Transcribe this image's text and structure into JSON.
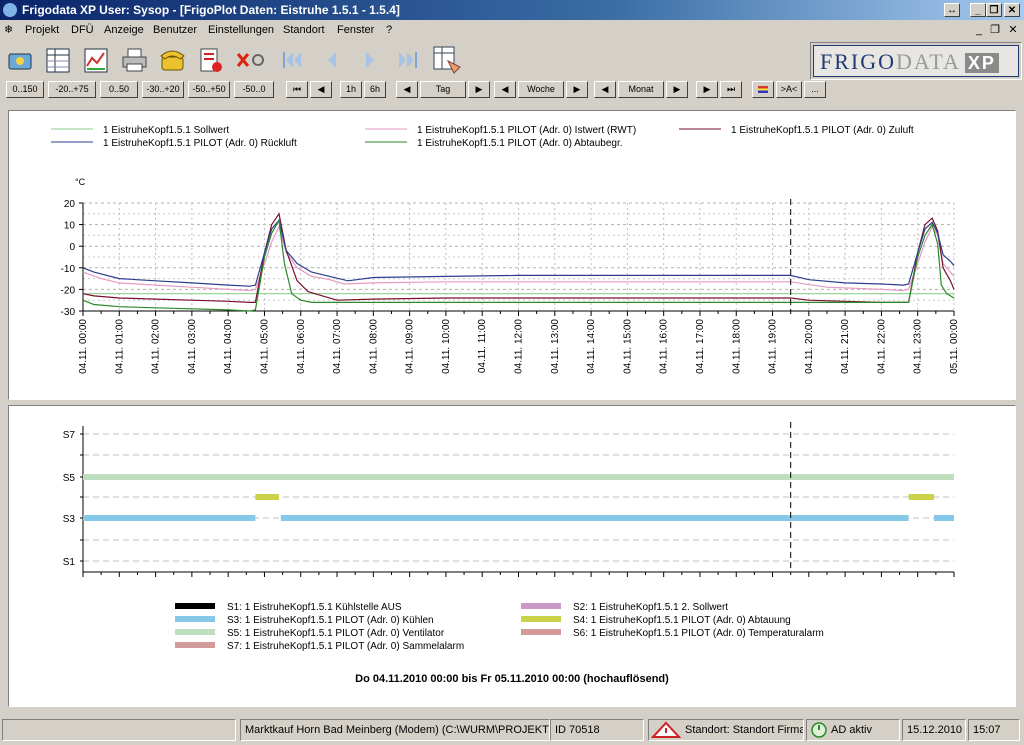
{
  "window": {
    "title": "Frigodata XP  User: Sysop - [FrigoPlot Daten: Eistruhe    1.5.1 - 1.5.4]"
  },
  "menu": {
    "items": [
      "Projekt",
      "DFÜ",
      "Anzeige",
      "Benutzer",
      "Einstellungen",
      "Standort",
      "Fenster",
      "?"
    ]
  },
  "toolbar": {
    "icons": [
      "projects-icon",
      "table-icon",
      "plot-icon",
      "print-icon",
      "phone-icon",
      "alarm-list-icon",
      "disconnect-icon",
      "first-icon",
      "prev-icon",
      "next-icon",
      "last-icon",
      "data-view-icon"
    ]
  },
  "logo": {
    "part1": "FRIGO",
    "part2": "DATA",
    "part3": "XP"
  },
  "range_buttons": [
    "0..150",
    "-20..+75",
    "0..50",
    "-30..+20",
    "-50..+50",
    "-50..0"
  ],
  "nav_buttons": {
    "h1": "1h",
    "h6": "6h",
    "day": "Tag",
    "week": "Woche",
    "month": "Monat",
    "ac": ">A<",
    "more": "..."
  },
  "chart_data": [
    {
      "type": "line",
      "ylabel": "°C",
      "ylim": [
        -30,
        20
      ],
      "yticks": [
        20,
        10,
        0,
        -10,
        -20,
        -30
      ],
      "yticks_minor": [
        15,
        5,
        -5,
        -15,
        -25
      ],
      "x_tick_labels": [
        "04.11. 00:00",
        "04.11. 01:00",
        "04.11. 02:00",
        "04.11. 03:00",
        "04.11. 04:00",
        "04.11. 05:00",
        "04.11. 06:00",
        "04.11. 07:00",
        "04.11. 08:00",
        "04.11. 09:00",
        "04.11. 10:00",
        "04.11. 11:00",
        "04.11. 12:00",
        "04.11. 13:00",
        "04.11. 14:00",
        "04.11. 15:00",
        "04.11. 16:00",
        "04.11. 17:00",
        "04.11. 18:00",
        "04.11. 19:00",
        "04.11. 20:00",
        "04.11. 21:00",
        "04.11. 22:00",
        "04.11. 23:00",
        "05.11. 00:00"
      ],
      "xlim": [
        0,
        24
      ],
      "cursor_x": 19.5,
      "grid": true,
      "legend": [
        {
          "name": "1 EistruheKopf1.5.1  Sollwert",
          "color": "#8ed18e"
        },
        {
          "name": "1 EistruheKopf1.5.1  PILOT (Adr. 0) Istwert (RWT)",
          "color": "#e79ac4"
        },
        {
          "name": "1 EistruheKopf1.5.1  PILOT (Adr. 0) Zuluft",
          "color": "#7a1030"
        },
        {
          "name": "1 EistruheKopf1.5.1  PILOT (Adr. 0) Rückluft",
          "color": "#2c3d8f"
        },
        {
          "name": "1 EistruheKopf1.5.1  PILOT (Adr. 0) Abtaubegr.",
          "color": "#2a8a2a"
        }
      ],
      "series": [
        {
          "name": "1 EistruheKopf1.5.1  Sollwert",
          "color": "#8ed18e",
          "x": [
            0,
            24
          ],
          "y": [
            -22,
            -22
          ]
        },
        {
          "name": "1 EistruheKopf1.5.1  PILOT (Adr. 0) Istwert (RWT)",
          "color": "#e79ac4",
          "x": [
            0,
            0.5,
            1,
            2,
            3,
            4,
            4.6,
            4.75,
            5.0,
            5.2,
            5.4,
            5.6,
            5.9,
            6.3,
            6.8,
            7.2,
            8,
            10,
            12,
            14,
            16,
            18,
            19.5,
            20.5,
            22,
            22.6,
            22.75,
            23.0,
            23.2,
            23.4,
            23.55,
            23.7,
            23.9,
            24
          ],
          "y": [
            -12,
            -15,
            -17,
            -18,
            -19,
            -20,
            -20.5,
            -20,
            -8,
            2,
            9,
            -3,
            -10,
            -14,
            -15.5,
            -17.5,
            -17,
            -16.5,
            -16.5,
            -16.5,
            -16.5,
            -16.5,
            -16.5,
            -19,
            -20,
            -20.5,
            -20,
            -8,
            2,
            9,
            5,
            -8,
            -12,
            -14
          ]
        },
        {
          "name": "1 EistruheKopf1.5.1  PILOT (Adr. 0) Zuluft",
          "color": "#7a1030",
          "x": [
            0,
            0.3,
            1,
            2,
            3,
            4,
            4.6,
            4.75,
            5.0,
            5.2,
            5.4,
            5.6,
            5.9,
            6.2,
            6.6,
            7,
            8,
            10,
            12,
            14,
            16,
            18,
            19.5,
            20,
            21,
            22,
            22.55,
            22.75,
            23.0,
            23.2,
            23.4,
            23.55,
            23.7,
            23.9,
            24
          ],
          "y": [
            -22,
            -23,
            -24,
            -24.5,
            -25,
            -25.5,
            -26,
            -26,
            -3,
            10,
            15,
            -2,
            -16,
            -21,
            -23,
            -25,
            -24.5,
            -24,
            -24,
            -24,
            -24,
            -24,
            -24,
            -25,
            -25.5,
            -26,
            -26,
            -26,
            -3,
            10,
            13,
            7,
            -10,
            -16,
            -20
          ]
        },
        {
          "name": "1 EistruheKopf1.5.1  PILOT (Adr. 0) Rückluft",
          "color": "#2c3d8f",
          "x": [
            0,
            0.3,
            1,
            2,
            3,
            4,
            4.6,
            4.75,
            5.0,
            5.2,
            5.4,
            5.6,
            5.9,
            6.3,
            6.8,
            7.3,
            8,
            10,
            12,
            14,
            16,
            18,
            19.5,
            20,
            21,
            22,
            22.6,
            22.75,
            23.0,
            23.2,
            23.4,
            23.55,
            23.7,
            23.9,
            24
          ],
          "y": [
            -10,
            -12,
            -15,
            -16,
            -17,
            -18,
            -18.5,
            -18,
            -3,
            8,
            12,
            -2,
            -8,
            -12,
            -14,
            -16,
            -14.5,
            -14,
            -13.5,
            -13.5,
            -13.5,
            -13.5,
            -13.5,
            -15.5,
            -17,
            -17.5,
            -18,
            -17.5,
            -3,
            8,
            11,
            6,
            -4,
            -7,
            -9
          ]
        },
        {
          "name": "1 EistruheKopf1.5.1  PILOT (Adr. 0) Abtaubegr.",
          "color": "#2a8a2a",
          "x": [
            0,
            0.3,
            1,
            2,
            3,
            4,
            4.6,
            4.75,
            5.0,
            5.2,
            5.4,
            5.55,
            5.75,
            6.0,
            6.3,
            8,
            12,
            16,
            20,
            22,
            22.6,
            22.75,
            23.0,
            23.2,
            23.4,
            23.55,
            23.65,
            23.8,
            24
          ],
          "y": [
            -25,
            -27,
            -28,
            -28.5,
            -29,
            -29.5,
            -30,
            -29.5,
            -5,
            6,
            12,
            -8,
            -22,
            -25,
            -26,
            -26,
            -26,
            -26,
            -26,
            -26,
            -26,
            -26,
            -5,
            5,
            10,
            1,
            -18,
            -22,
            -24
          ]
        }
      ]
    },
    {
      "type": "status",
      "xlim": [
        0,
        24
      ],
      "cursor_x": 19.5,
      "yticks": [
        "S7",
        "S5",
        "S3",
        "S1"
      ],
      "legend": [
        {
          "name": "S1: 1 EistruheKopf1.5.1  Kühlstelle AUS",
          "color": "#000000"
        },
        {
          "name": "S2: 1 EistruheKopf1.5.1  2. Sollwert",
          "color": "#c999c9"
        },
        {
          "name": "S3: 1 EistruheKopf1.5.1  PILOT (Adr. 0) Kühlen",
          "color": "#86c8e8"
        },
        {
          "name": "S4: 1 EistruheKopf1.5.1  PILOT (Adr. 0) Abtauung",
          "color": "#cad24a"
        },
        {
          "name": "S5: 1 EistruheKopf1.5.1  PILOT (Adr. 0) Ventilator",
          "color": "#bfddbf"
        },
        {
          "name": "S6: 1 EistruheKopf1.5.1  PILOT (Adr. 0) Temperaturalarm",
          "color": "#d29a9a"
        },
        {
          "name": "S7: 1 EistruheKopf1.5.1  PILOT (Adr. 0) Sammelalarm",
          "color": "#d29a9a"
        }
      ],
      "bars": [
        {
          "signal": "S5",
          "color": "#bfddbf",
          "segments": [
            [
              0,
              24
            ]
          ]
        },
        {
          "signal": "S4",
          "color": "#cad24a",
          "segments": [
            [
              4.75,
              5.4
            ],
            [
              22.75,
              23.45
            ]
          ]
        },
        {
          "signal": "S3",
          "color": "#86c8e8",
          "segments": [
            [
              0,
              4.75
            ],
            [
              5.45,
              22.75
            ],
            [
              23.45,
              24
            ]
          ]
        }
      ],
      "caption": "Do 04.11.2010 00:00 bis Fr 05.11.2010 00:00 (hochauflösend)"
    }
  ],
  "status": {
    "project": "Marktkauf Horn Bad Meinberg (Modem) (C:\\WURM\\PROJEKTE\\)",
    "id": "ID 70518",
    "standort": "Standort: Standort Firma",
    "ad": "AD aktiv",
    "date": "15.12.2010",
    "time": "15:07"
  }
}
